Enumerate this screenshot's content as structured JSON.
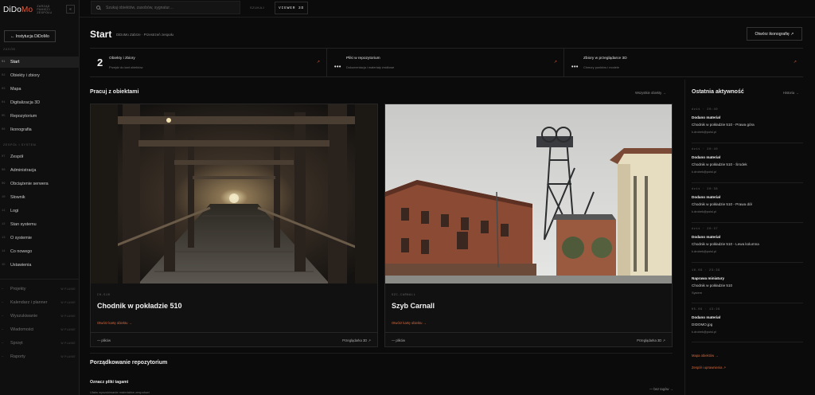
{
  "brand": {
    "logo_a": "DiDo",
    "logo_b": "Mo",
    "sub1": "ZARZĄD",
    "sub2": "PAMIĘCI",
    "sub3": "ZESPOŁU",
    "collapse": "«"
  },
  "sidebar": {
    "institution_button": "← Instytucja DiDoMo",
    "section_main": "ZASÓB",
    "section_team": "ZESPÓŁ I SYSTEM",
    "main_items": [
      {
        "num": "01",
        "label": "Start"
      },
      {
        "num": "02",
        "label": "Obiekty i zbiory"
      },
      {
        "num": "03",
        "label": "Mapa"
      },
      {
        "num": "04",
        "label": "Digitalizacja 3D"
      },
      {
        "num": "05",
        "label": "Repozytorium"
      },
      {
        "num": "06",
        "label": "Ikonografia"
      }
    ],
    "team_items": [
      {
        "num": "07",
        "label": "Zespół"
      },
      {
        "num": "08",
        "label": "Administracja"
      },
      {
        "num": "09",
        "label": "Obciążenie serwera"
      },
      {
        "num": "10",
        "label": "Słownik"
      },
      {
        "num": "11",
        "label": "Logi"
      },
      {
        "num": "12",
        "label": "Stan systemu"
      },
      {
        "num": "13",
        "label": "O systemie"
      },
      {
        "num": "14",
        "label": "Co nowego"
      },
      {
        "num": "15",
        "label": "Ustawienia"
      }
    ],
    "planned_items": [
      {
        "num": "—",
        "label": "Projekty",
        "tag": "W PLANIE"
      },
      {
        "num": "—",
        "label": "Kalendarz i planner",
        "tag": "W PLANIE"
      },
      {
        "num": "—",
        "label": "Wyszukiwanie",
        "tag": "W PLANIE"
      },
      {
        "num": "—",
        "label": "Wiadomości",
        "tag": "W PLANIE"
      },
      {
        "num": "—",
        "label": "Sprzęt",
        "tag": "W PLANIE"
      },
      {
        "num": "—",
        "label": "Raporty",
        "tag": "W PLANIE"
      }
    ]
  },
  "topbar": {
    "search_placeholder": "Szukaj obiektów, zasobów, sygnatur…",
    "search_button": "SZUKAJ",
    "viewer_button": "VIEWER 3D"
  },
  "header": {
    "title": "Start",
    "breadcrumb": "DiDoMo Zabrze · Przestrzeń zespołu",
    "ikonografia_button": "Otwórz ikonografię ↗"
  },
  "stats": [
    {
      "value": "2",
      "title": "Obiekty i zbiory",
      "sub": "Przejdź do kart obiektów",
      "arrow": "↗"
    },
    {
      "value": "•••",
      "title": "Pliki w repozytorium",
      "sub": "Dokumentacja i materiały źródłowe",
      "arrow": "↗"
    },
    {
      "value": "•••",
      "title": "Zbiory w przeglądarce 3D",
      "sub": "Chmury punktów i modele",
      "arrow": "↗"
    }
  ],
  "work": {
    "title": "Pracuj z obiektami",
    "all_link": "Wszystkie obiekty →",
    "cards": [
      {
        "code": "CH-510",
        "title": "Chodnik w pokładzie 510",
        "link": "Otwórz kartę obiektu →",
        "files": "— plików",
        "viewer": "Przeglądarka 3D ↗"
      },
      {
        "code": "SZC-CARNALL",
        "title": "Szyb Carnall",
        "link": "Otwórz kartę obiektu →",
        "files": "— plików",
        "viewer": "Przeglądarka 3D ↗"
      }
    ]
  },
  "repo": {
    "title": "Porządkowanie repozytorium",
    "task_title": "Oznacz pliki tagami",
    "task_desc": "Ułatw wyszukiwanie materiałów zespołowi",
    "task_link": "— bez tagów →"
  },
  "activity": {
    "title": "Ostatnia aktywność",
    "history_link": "Historia →",
    "items": [
      {
        "time": "dziś · 20:40",
        "type": "Dodano materiał",
        "title": "Chodnik w pokładzie 510 - Prawa góra",
        "user": "k.drobek@polsl.pl"
      },
      {
        "time": "dziś · 20:40",
        "type": "Dodano materiał",
        "title": "Chodnik w pokładzie 510 - Środek",
        "user": "k.drobek@polsl.pl"
      },
      {
        "time": "dziś · 20:38",
        "type": "Dodano materiał",
        "title": "Chodnik w pokładzie 510 - Prawa dół",
        "user": "k.drobek@polsl.pl"
      },
      {
        "time": "dziś · 20:37",
        "type": "Dodano materiał",
        "title": "Chodnik w pokładzie 510 - Lewa kolumna",
        "user": "k.drobek@polsl.pl"
      },
      {
        "time": "16.09 · 23:39",
        "type": "Naprawa miniatury",
        "title": "Chodnik w pokładzie 510",
        "user": "System"
      },
      {
        "time": "05.09 · 13:29",
        "type": "Dodano materiał",
        "title": "DIDOMO.jpg",
        "user": "k.drobek@polsl.pl"
      }
    ],
    "link_map": "Mapa obiektów →",
    "link_team": "Zespół i uprawnienia ↗"
  }
}
